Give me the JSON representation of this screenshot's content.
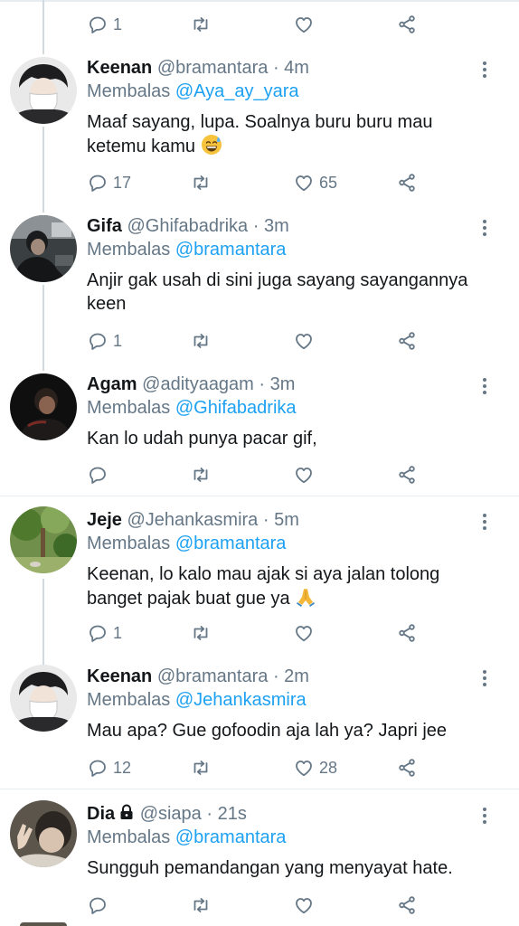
{
  "top_actions": {
    "reply_count": "1",
    "retweet_count": "",
    "like_count": ""
  },
  "tweets": [
    {
      "name": "Keenan",
      "handle": "@bramantara",
      "time": "· 4m",
      "replying_prefix": "Membalas",
      "replying_to": "@Aya_ay_yara",
      "text": "Maaf sayang, lupa. Soalnya buru buru mau ketemu kamu",
      "emoji": "sweat-smile-emoji",
      "reply_count": "17",
      "retweet_count": "",
      "like_count": "65"
    },
    {
      "name": "Gifa",
      "handle": "@Ghifabadrika",
      "time": "· 3m",
      "replying_prefix": "Membalas",
      "replying_to": "@bramantara",
      "text": "Anjir gak usah di sini juga sayang sayangannya keen",
      "reply_count": "1",
      "retweet_count": "",
      "like_count": ""
    },
    {
      "name": "Agam",
      "handle": "@adityaagam",
      "time": "· 3m",
      "replying_prefix": "Membalas",
      "replying_to": "@Ghifabadrika",
      "text": "Kan lo udah punya pacar gif,",
      "reply_count": "",
      "retweet_count": "",
      "like_count": ""
    },
    {
      "name": "Jeje",
      "handle": "@Jehankasmira",
      "time": "· 5m",
      "replying_prefix": "Membalas",
      "replying_to": "@bramantara",
      "text": "Keenan, lo kalo mau ajak si aya jalan tolong banget pajak buat gue ya",
      "emoji": "folded-hands-emoji",
      "reply_count": "1",
      "retweet_count": "",
      "like_count": ""
    },
    {
      "name": "Keenan",
      "handle": "@bramantara",
      "time": "· 2m",
      "replying_prefix": "Membalas",
      "replying_to": "@Jehankasmira",
      "text": "Mau apa? Gue gofoodin aja lah ya? Japri jee",
      "reply_count": "12",
      "retweet_count": "",
      "like_count": "28"
    },
    {
      "name": "Dia",
      "handle": "@siapa",
      "time": "· 21s",
      "replying_prefix": "Membalas",
      "replying_to": "@bramantara",
      "text": "Sungguh pemandangan yang menyayat hate.",
      "locked": "lock-icon",
      "reply_count": "",
      "retweet_count": "",
      "like_count": ""
    }
  ],
  "colors": {
    "text": "#14171a",
    "secondary": "#657786",
    "link": "#1da1f2",
    "divider": "#e6ecf0",
    "thread_line": "#cfd9de"
  }
}
